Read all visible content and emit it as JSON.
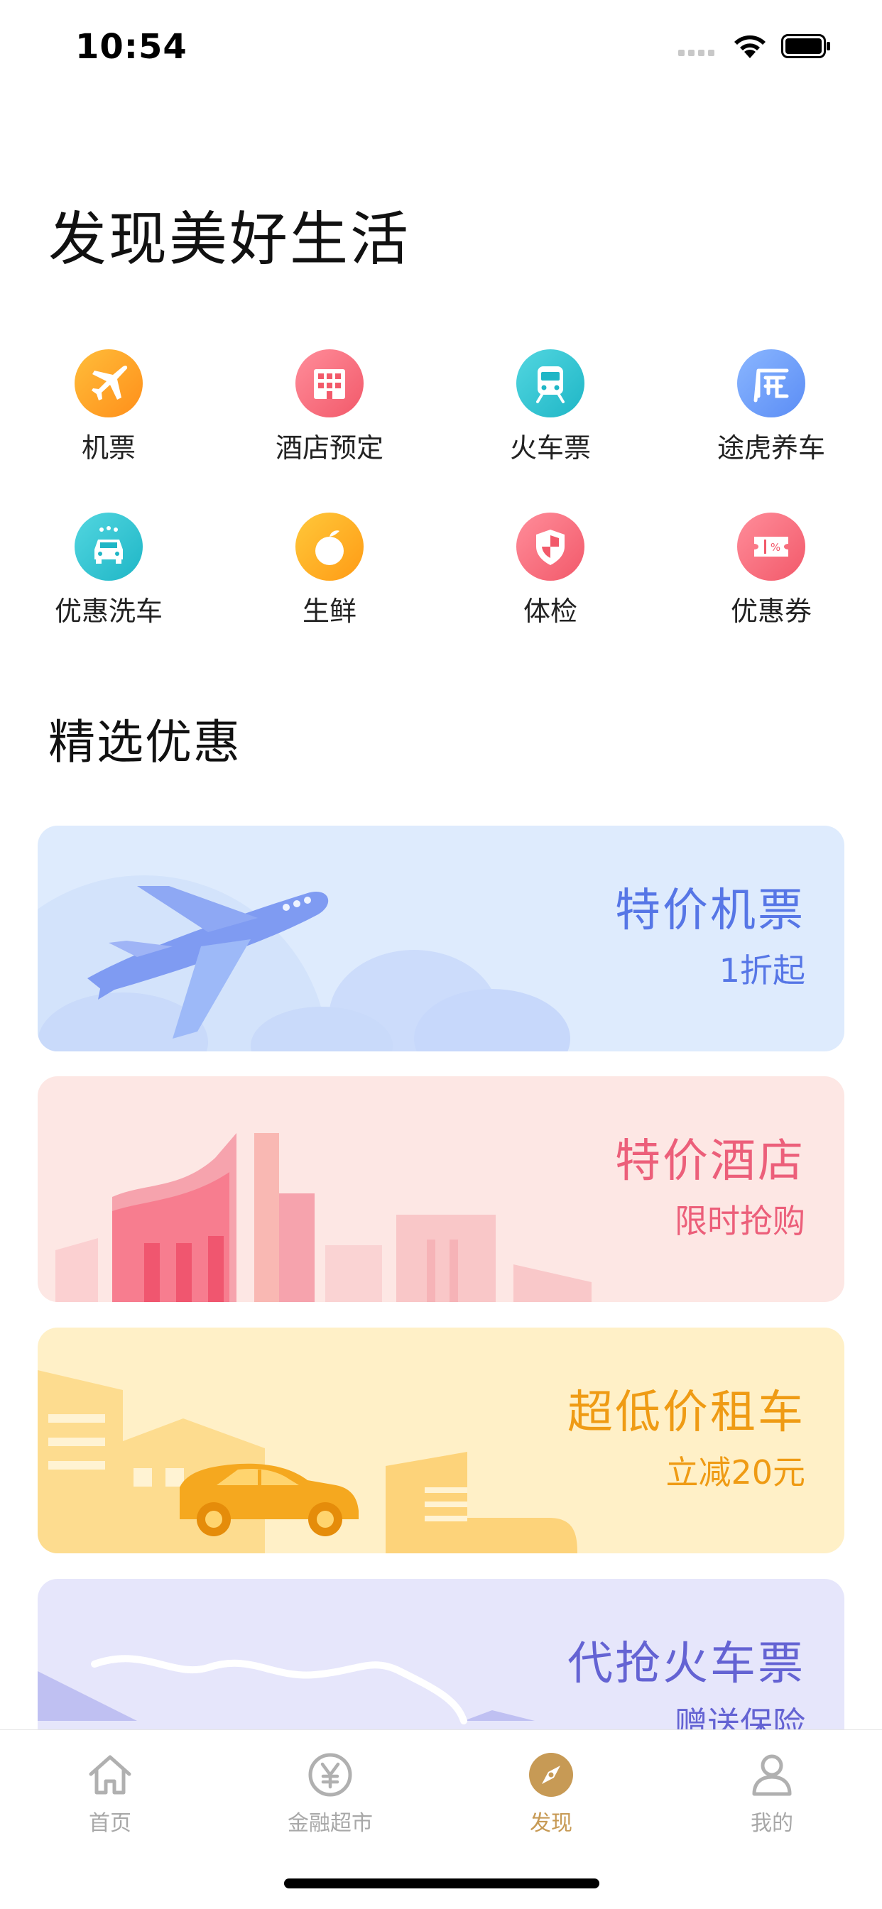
{
  "status_bar": {
    "time": "10:54"
  },
  "page_title": "发现美好生活",
  "quick_links": [
    {
      "label": "机票",
      "icon": "airplane-icon",
      "color_from": "#ffbd3a",
      "color_to": "#ff8f1a"
    },
    {
      "label": "酒店预定",
      "icon": "building-icon",
      "color_from": "#ff8d9a",
      "color_to": "#f2596a"
    },
    {
      "label": "火车票",
      "icon": "train-icon",
      "color_from": "#52d6e0",
      "color_to": "#1fb6c6"
    },
    {
      "label": "途虎养车",
      "icon": "tuhu-icon",
      "color_from": "#8ab6ff",
      "color_to": "#5b8df5"
    },
    {
      "label": "优惠洗车",
      "icon": "car-wash-icon",
      "color_from": "#52d6e0",
      "color_to": "#1fb6c6"
    },
    {
      "label": "生鲜",
      "icon": "fruit-icon",
      "color_from": "#ffc83a",
      "color_to": "#ff9b15"
    },
    {
      "label": "体检",
      "icon": "shield-icon",
      "color_from": "#ff8d9a",
      "color_to": "#f2596a"
    },
    {
      "label": "优惠券",
      "icon": "coupon-icon",
      "color_from": "#ff8d9a",
      "color_to": "#f2596a"
    }
  ],
  "section_title": "精选优惠",
  "banners": [
    {
      "title": "特价机票",
      "subtitle": "1折起",
      "bg": "#deebfd",
      "text_color": "#5676e6",
      "art": "airplane-illustration"
    },
    {
      "title": "特价酒店",
      "subtitle": "限时抢购",
      "bg": "#fde7e4",
      "text_color": "#ec5f7a",
      "art": "hotel-illustration"
    },
    {
      "title": "超低价租车",
      "subtitle": "立减20元",
      "bg": "#fff0c7",
      "text_color": "#ef9b14",
      "art": "car-illustration"
    },
    {
      "title": "代抢火车票",
      "subtitle": "赠送保险",
      "bg": "#e6e6fb",
      "text_color": "#6463d3",
      "art": "mountain-illustration"
    }
  ],
  "tabs": [
    {
      "label": "首页",
      "icon": "home-icon",
      "active": false
    },
    {
      "label": "金融超市",
      "icon": "yen-icon",
      "active": false
    },
    {
      "label": "发现",
      "icon": "compass-icon",
      "active": true
    },
    {
      "label": "我的",
      "icon": "person-icon",
      "active": false
    }
  ],
  "colors": {
    "accent": "#c79a55",
    "inactive": "#a8a8a8"
  }
}
